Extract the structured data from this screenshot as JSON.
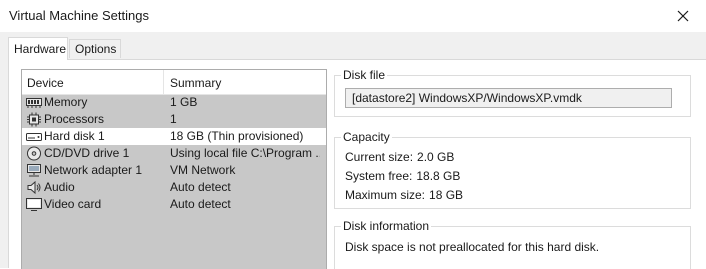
{
  "window": {
    "title": "Virtual Machine Settings",
    "close_icon": "close-icon"
  },
  "tabs": [
    {
      "label": "Hardware",
      "active": true
    },
    {
      "label": "Options",
      "active": false
    }
  ],
  "device_list": {
    "columns": [
      "Device",
      "Summary"
    ],
    "rows": [
      {
        "icon": "memory-icon",
        "device": "Memory",
        "summary": "1 GB",
        "selected": false
      },
      {
        "icon": "processor-icon",
        "device": "Processors",
        "summary": "1",
        "selected": false
      },
      {
        "icon": "hard-disk-icon",
        "device": "Hard disk 1",
        "summary": "18 GB (Thin provisioned)",
        "selected": true
      },
      {
        "icon": "cd-dvd-icon",
        "device": "CD/DVD drive 1",
        "summary": "Using local file C:\\Program ...",
        "selected": false
      },
      {
        "icon": "network-adapter-icon",
        "device": "Network adapter 1",
        "summary": "VM Network",
        "selected": false
      },
      {
        "icon": "audio-icon",
        "device": "Audio",
        "summary": "Auto detect",
        "selected": false
      },
      {
        "icon": "video-card-icon",
        "device": "Video card",
        "summary": "Auto detect",
        "selected": false
      }
    ]
  },
  "disk_file": {
    "label": "Disk file",
    "value": "[datastore2] WindowsXP/WindowsXP.vmdk"
  },
  "capacity": {
    "label": "Capacity",
    "current_size_label": "Current size:",
    "current_size_value": "2.0 GB",
    "system_free_label": "System free:",
    "system_free_value": "18.8 GB",
    "maximum_size_label": "Maximum size:",
    "maximum_size_value": "18 GB"
  },
  "disk_information": {
    "label": "Disk information",
    "text": "Disk space is not preallocated for this hard disk."
  },
  "colors": {
    "list_background": "#c8c8c8",
    "selected_row": "#ffffff",
    "dialog_background": "#f0f0f0"
  }
}
